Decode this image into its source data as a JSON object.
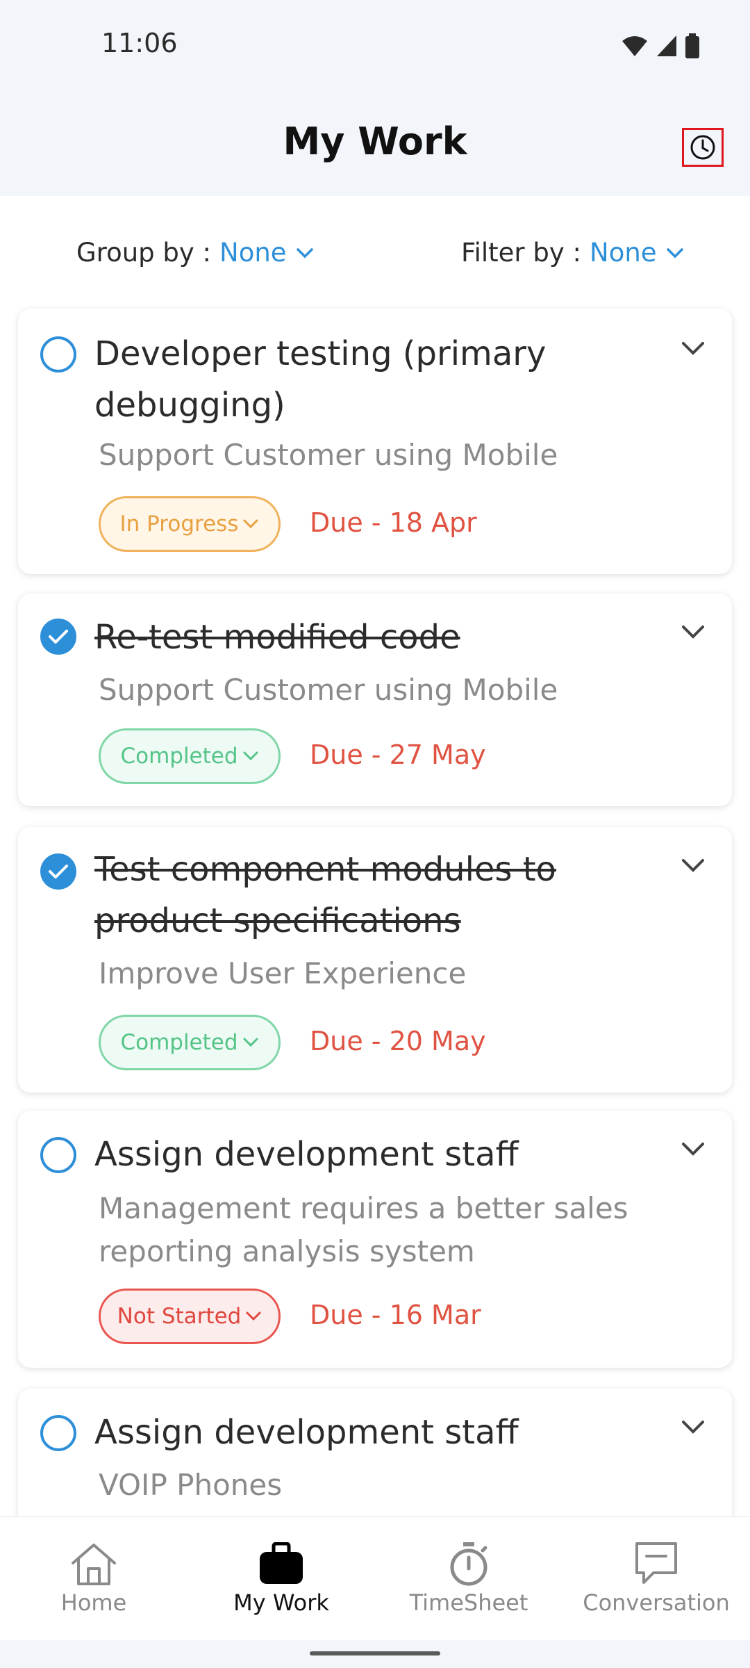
{
  "status_bar": {
    "time": "11:06"
  },
  "header": {
    "title": "My Work"
  },
  "filters": {
    "group_by_label": "Group by :",
    "group_by_value": "None",
    "filter_by_label": "Filter by :",
    "filter_by_value": "None"
  },
  "tasks": [
    {
      "title": "Developer testing (primary debugging)",
      "project": "Support Customer using Mobile",
      "status": "In Progress",
      "due": "Due - 18 Apr",
      "completed": false
    },
    {
      "title": "Re-test modified code",
      "project": "Support Customer using Mobile",
      "status": "Completed",
      "due": "Due - 27 May",
      "completed": true
    },
    {
      "title": "Test component modules to product specifications",
      "project": "Improve User Experience",
      "status": "Completed",
      "due": "Due - 20 May",
      "completed": true
    },
    {
      "title": "Assign development staff",
      "project": "Management requires a better sales reporting analysis system",
      "status": "Not Started",
      "due": "Due - 16 Mar",
      "completed": false
    },
    {
      "title": "Assign development staff",
      "project": "VOIP Phones",
      "status": "",
      "due": "",
      "completed": false
    }
  ],
  "bottom_nav": [
    {
      "label": "Home",
      "icon": "home-icon",
      "active": false
    },
    {
      "label": "My Work",
      "icon": "briefcase-icon",
      "active": true
    },
    {
      "label": "TimeSheet",
      "icon": "stopwatch-icon",
      "active": false
    },
    {
      "label": "Conversation",
      "icon": "chat-icon",
      "active": false
    }
  ],
  "colors": {
    "accent": "#2e8fd9",
    "due": "#e05241",
    "in_progress": "#e8a040",
    "completed": "#55c488",
    "not_started": "#e0483f",
    "highlight_box": "#e0161e"
  }
}
